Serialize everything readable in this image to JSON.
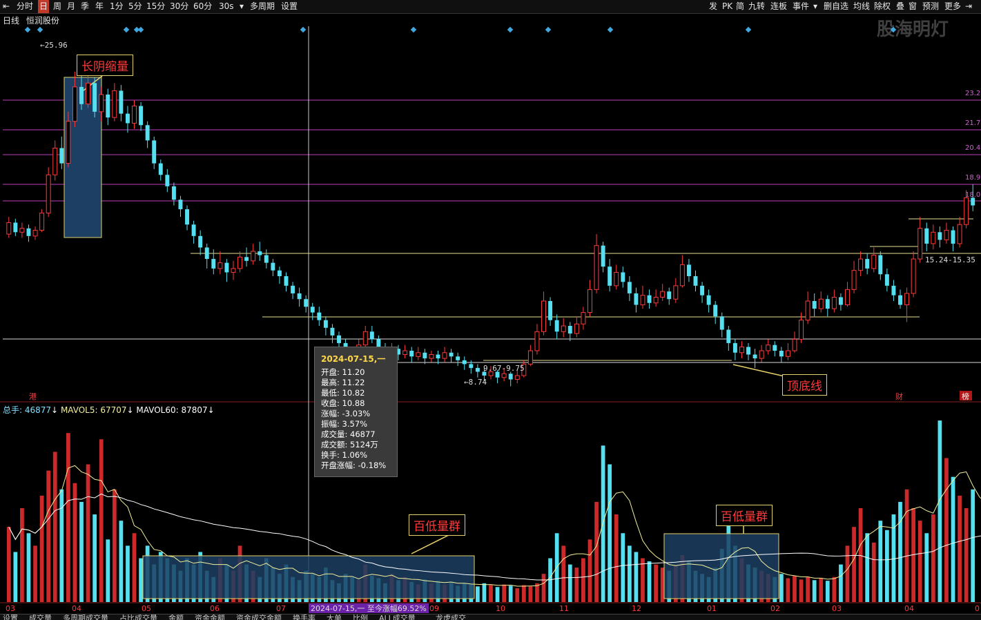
{
  "toolbar": {
    "left": [
      "分时",
      "日",
      "周",
      "月",
      "季",
      "年",
      "1分",
      "5分",
      "15分",
      "30分",
      "60分",
      "30s",
      "多周期",
      "设置"
    ],
    "active": "日",
    "right": [
      "发",
      "PK",
      "简",
      "九转",
      "连板",
      "事件",
      "删自选",
      "均线",
      "除权",
      "叠",
      "窗",
      "预测",
      "更多"
    ]
  },
  "info": {
    "period": "日线",
    "stock": "恒润股份"
  },
  "watermark": "股海明灯",
  "price_labels": {
    "high": "25.96",
    "low": "8.74",
    "range_low": "9.67-9.75",
    "range_high": "15.24-15.35"
  },
  "right_axis": [
    "23.2",
    "21.7",
    "20.4",
    "18.9",
    "18.0"
  ],
  "markers": {
    "hk": "港",
    "cai": "财",
    "bang": "榜"
  },
  "annotations": {
    "long_bear": "长阴缩量",
    "top_bottom": "顶底线",
    "low_vol_1": "百低量群",
    "low_vol_2": "百低量群"
  },
  "tooltip": {
    "date": "2024-07-15,一",
    "rows": [
      {
        "label": "开盘",
        "value": "11.20"
      },
      {
        "label": "最高",
        "value": "11.22"
      },
      {
        "label": "最低",
        "value": "10.82"
      },
      {
        "label": "收盘",
        "value": "10.88"
      },
      {
        "label": "涨幅",
        "value": "-3.03%"
      },
      {
        "label": "振幅",
        "value": "3.57%"
      },
      {
        "label": "成交量",
        "value": "46877"
      },
      {
        "label": "成交额",
        "value": "5124万"
      },
      {
        "label": "换手",
        "value": "1.06%"
      },
      {
        "label": "开盘涨幅",
        "value": "-0.18%"
      }
    ]
  },
  "volume_legend": {
    "total": "总手: 46877",
    "ma5": "MAVOL5: 67707",
    "ma60": "MAVOL60: 87807"
  },
  "cursor_label": "2024-07-15,一 至今涨幅69.52%",
  "bottom_tabs": [
    "设置",
    "成交量",
    "多周期成交量",
    "占比成交量",
    "金额",
    "资金金额",
    "资金成交金额",
    "换手率",
    "大单",
    "比例",
    "ALL成交量",
    "龙虎成交"
  ],
  "chart_data": {
    "type": "candlestick",
    "title": "恒润股份 日线",
    "x_months": [
      "03",
      "04",
      "05",
      "06",
      "07",
      "08",
      "09",
      "10",
      "11",
      "12",
      "01",
      "02",
      "03",
      "04",
      "0"
    ],
    "price": {
      "ylim": [
        8.0,
        27.5
      ],
      "candles": [
        {
          "o": 16.7,
          "c": 17.3,
          "h": 17.6,
          "l": 16.5
        },
        {
          "o": 17.3,
          "c": 16.8,
          "h": 17.5,
          "l": 16.6
        },
        {
          "o": 16.8,
          "c": 17.0,
          "h": 17.3,
          "l": 16.5
        },
        {
          "o": 17.0,
          "c": 16.6,
          "h": 17.2,
          "l": 16.3
        },
        {
          "o": 16.6,
          "c": 16.9,
          "h": 17.1,
          "l": 16.4
        },
        {
          "o": 16.9,
          "c": 17.8,
          "h": 18.0,
          "l": 16.8
        },
        {
          "o": 17.8,
          "c": 19.8,
          "h": 20.2,
          "l": 17.6
        },
        {
          "o": 19.8,
          "c": 21.2,
          "h": 21.6,
          "l": 19.5
        },
        {
          "o": 21.2,
          "c": 20.4,
          "h": 21.8,
          "l": 20.1
        },
        {
          "o": 20.4,
          "c": 22.6,
          "h": 23.1,
          "l": 20.2
        },
        {
          "o": 22.6,
          "c": 24.4,
          "h": 25.2,
          "l": 22.3
        },
        {
          "o": 24.4,
          "c": 23.5,
          "h": 25.4,
          "l": 23.2
        },
        {
          "o": 23.5,
          "c": 24.6,
          "h": 25.96,
          "l": 23.3
        },
        {
          "o": 24.6,
          "c": 23.1,
          "h": 24.9,
          "l": 22.8
        },
        {
          "o": 23.1,
          "c": 24.0,
          "h": 24.4,
          "l": 22.6
        },
        {
          "o": 24.0,
          "c": 22.8,
          "h": 24.3,
          "l": 22.4
        },
        {
          "o": 22.8,
          "c": 24.2,
          "h": 24.6,
          "l": 22.6
        },
        {
          "o": 24.2,
          "c": 23.0,
          "h": 24.5,
          "l": 22.6
        },
        {
          "o": 23.0,
          "c": 22.5,
          "h": 23.4,
          "l": 22.0
        },
        {
          "o": 22.5,
          "c": 23.4,
          "h": 23.7,
          "l": 22.2
        },
        {
          "o": 23.4,
          "c": 22.4,
          "h": 23.6,
          "l": 22.1
        },
        {
          "o": 22.4,
          "c": 21.6,
          "h": 22.6,
          "l": 21.2
        },
        {
          "o": 21.6,
          "c": 20.4,
          "h": 21.8,
          "l": 20.1
        },
        {
          "o": 20.4,
          "c": 19.8,
          "h": 20.6,
          "l": 19.5
        },
        {
          "o": 19.8,
          "c": 19.2,
          "h": 20.1,
          "l": 18.9
        },
        {
          "o": 19.2,
          "c": 18.5,
          "h": 19.4,
          "l": 18.2
        },
        {
          "o": 18.5,
          "c": 18.0,
          "h": 18.7,
          "l": 17.6
        },
        {
          "o": 18.0,
          "c": 17.2,
          "h": 18.2,
          "l": 16.9
        },
        {
          "o": 17.2,
          "c": 16.6,
          "h": 17.4,
          "l": 16.2
        },
        {
          "o": 16.6,
          "c": 16.0,
          "h": 16.9,
          "l": 15.6
        },
        {
          "o": 16.0,
          "c": 15.4,
          "h": 16.2,
          "l": 14.9
        },
        {
          "o": 15.4,
          "c": 14.9,
          "h": 15.9,
          "l": 14.6
        },
        {
          "o": 14.9,
          "c": 15.2,
          "h": 15.8,
          "l": 14.6
        },
        {
          "o": 15.2,
          "c": 14.7,
          "h": 15.4,
          "l": 14.2
        },
        {
          "o": 14.7,
          "c": 14.9,
          "h": 15.3,
          "l": 14.3
        },
        {
          "o": 14.9,
          "c": 15.5,
          "h": 15.8,
          "l": 14.7
        },
        {
          "o": 15.5,
          "c": 15.3,
          "h": 16.0,
          "l": 15.0
        },
        {
          "o": 15.3,
          "c": 15.8,
          "h": 16.2,
          "l": 15.1
        },
        {
          "o": 15.8,
          "c": 15.6,
          "h": 16.3,
          "l": 15.3
        },
        {
          "o": 15.6,
          "c": 15.2,
          "h": 15.9,
          "l": 14.9
        },
        {
          "o": 15.2,
          "c": 14.8,
          "h": 15.4,
          "l": 14.5
        },
        {
          "o": 14.8,
          "c": 14.5,
          "h": 15.0,
          "l": 14.1
        },
        {
          "o": 14.5,
          "c": 14.0,
          "h": 14.7,
          "l": 13.7
        },
        {
          "o": 14.0,
          "c": 13.6,
          "h": 14.2,
          "l": 13.3
        },
        {
          "o": 13.6,
          "c": 13.3,
          "h": 13.9,
          "l": 12.9
        },
        {
          "o": 13.3,
          "c": 12.9,
          "h": 13.5,
          "l": 12.6
        },
        {
          "o": 12.9,
          "c": 12.6,
          "h": 13.1,
          "l": 12.2
        },
        {
          "o": 12.6,
          "c": 12.2,
          "h": 12.9,
          "l": 11.9
        },
        {
          "o": 12.2,
          "c": 11.8,
          "h": 12.4,
          "l": 11.4
        },
        {
          "o": 11.8,
          "c": 11.4,
          "h": 12.0,
          "l": 11.0
        },
        {
          "o": 11.4,
          "c": 11.0,
          "h": 11.6,
          "l": 10.7
        },
        {
          "o": 11.0,
          "c": 10.5,
          "h": 11.2,
          "l": 10.1
        },
        {
          "o": 10.5,
          "c": 10.2,
          "h": 10.8,
          "l": 9.9
        },
        {
          "o": 10.2,
          "c": 10.9,
          "h": 11.2,
          "l": 10.0
        },
        {
          "o": 10.9,
          "c": 11.6,
          "h": 11.9,
          "l": 10.6
        },
        {
          "o": 11.6,
          "c": 11.2,
          "h": 11.9,
          "l": 11.0
        },
        {
          "o": 11.2,
          "c": 10.8,
          "h": 11.4,
          "l": 10.5
        },
        {
          "o": 10.8,
          "c": 10.5,
          "h": 11.0,
          "l": 10.2
        },
        {
          "o": 10.5,
          "c": 10.7,
          "h": 11.0,
          "l": 10.3
        },
        {
          "o": 10.7,
          "c": 10.4,
          "h": 10.9,
          "l": 10.1
        },
        {
          "o": 10.4,
          "c": 10.6,
          "h": 10.9,
          "l": 10.2
        },
        {
          "o": 10.6,
          "c": 10.3,
          "h": 10.8,
          "l": 10.0
        },
        {
          "o": 10.3,
          "c": 10.5,
          "h": 10.8,
          "l": 10.1
        },
        {
          "o": 10.5,
          "c": 10.2,
          "h": 10.7,
          "l": 9.9
        },
        {
          "o": 10.2,
          "c": 10.4,
          "h": 10.6,
          "l": 10.0
        },
        {
          "o": 10.4,
          "c": 10.2,
          "h": 10.6,
          "l": 9.9
        },
        {
          "o": 10.2,
          "c": 10.5,
          "h": 10.8,
          "l": 10.0
        },
        {
          "o": 10.5,
          "c": 10.3,
          "h": 10.7,
          "l": 10.0
        },
        {
          "o": 10.3,
          "c": 10.1,
          "h": 10.5,
          "l": 9.8
        },
        {
          "o": 10.1,
          "c": 9.9,
          "h": 10.3,
          "l": 9.6
        },
        {
          "o": 9.9,
          "c": 9.7,
          "h": 10.1,
          "l": 9.4
        },
        {
          "o": 9.7,
          "c": 9.5,
          "h": 9.9,
          "l": 9.2
        },
        {
          "o": 9.5,
          "c": 9.3,
          "h": 9.7,
          "l": 9.0
        },
        {
          "o": 9.3,
          "c": 9.5,
          "h": 9.8,
          "l": 9.1
        },
        {
          "o": 9.5,
          "c": 9.2,
          "h": 9.6,
          "l": 8.9
        },
        {
          "o": 9.2,
          "c": 9.4,
          "h": 9.7,
          "l": 9.0
        },
        {
          "o": 9.4,
          "c": 9.1,
          "h": 9.5,
          "l": 8.74
        },
        {
          "o": 9.1,
          "c": 9.3,
          "h": 9.6,
          "l": 8.9
        },
        {
          "o": 9.3,
          "c": 9.9,
          "h": 10.1,
          "l": 9.2
        },
        {
          "o": 9.9,
          "c": 10.6,
          "h": 10.9,
          "l": 9.8
        },
        {
          "o": 10.6,
          "c": 11.6,
          "h": 12.0,
          "l": 10.4
        },
        {
          "o": 11.6,
          "c": 13.2,
          "h": 13.7,
          "l": 11.4
        },
        {
          "o": 13.2,
          "c": 12.2,
          "h": 13.4,
          "l": 11.9
        },
        {
          "o": 12.2,
          "c": 11.6,
          "h": 12.5,
          "l": 11.2
        },
        {
          "o": 11.6,
          "c": 11.9,
          "h": 12.3,
          "l": 11.3
        },
        {
          "o": 11.9,
          "c": 11.5,
          "h": 12.1,
          "l": 11.1
        },
        {
          "o": 11.5,
          "c": 12.0,
          "h": 12.4,
          "l": 11.3
        },
        {
          "o": 12.0,
          "c": 12.6,
          "h": 12.9,
          "l": 11.7
        },
        {
          "o": 12.6,
          "c": 13.8,
          "h": 14.3,
          "l": 12.4
        },
        {
          "o": 13.8,
          "c": 16.1,
          "h": 16.7,
          "l": 13.6
        },
        {
          "o": 16.1,
          "c": 15.0,
          "h": 16.3,
          "l": 14.7
        },
        {
          "o": 15.0,
          "c": 14.0,
          "h": 15.4,
          "l": 13.7
        },
        {
          "o": 14.0,
          "c": 14.7,
          "h": 15.1,
          "l": 13.8
        },
        {
          "o": 14.7,
          "c": 14.2,
          "h": 15.0,
          "l": 13.9
        },
        {
          "o": 14.2,
          "c": 13.6,
          "h": 14.5,
          "l": 13.2
        },
        {
          "o": 13.6,
          "c": 13.0,
          "h": 13.9,
          "l": 12.6
        },
        {
          "o": 13.0,
          "c": 13.5,
          "h": 14.0,
          "l": 12.8
        },
        {
          "o": 13.5,
          "c": 13.1,
          "h": 13.8,
          "l": 12.8
        },
        {
          "o": 13.1,
          "c": 13.4,
          "h": 13.8,
          "l": 12.9
        },
        {
          "o": 13.4,
          "c": 13.7,
          "h": 14.1,
          "l": 13.2
        },
        {
          "o": 13.7,
          "c": 13.3,
          "h": 13.9,
          "l": 13.0
        },
        {
          "o": 13.3,
          "c": 14.0,
          "h": 14.4,
          "l": 13.1
        },
        {
          "o": 14.0,
          "c": 15.1,
          "h": 15.6,
          "l": 13.9
        },
        {
          "o": 15.1,
          "c": 14.5,
          "h": 15.4,
          "l": 14.2
        },
        {
          "o": 14.5,
          "c": 14.0,
          "h": 14.8,
          "l": 13.7
        },
        {
          "o": 14.0,
          "c": 13.5,
          "h": 14.2,
          "l": 13.1
        },
        {
          "o": 13.5,
          "c": 13.0,
          "h": 13.8,
          "l": 12.6
        },
        {
          "o": 13.0,
          "c": 12.4,
          "h": 13.2,
          "l": 12.0
        },
        {
          "o": 12.4,
          "c": 11.7,
          "h": 12.6,
          "l": 11.3
        },
        {
          "o": 11.7,
          "c": 11.0,
          "h": 11.9,
          "l": 10.6
        },
        {
          "o": 11.0,
          "c": 10.5,
          "h": 11.2,
          "l": 10.1
        },
        {
          "o": 10.5,
          "c": 10.8,
          "h": 11.1,
          "l": 10.2
        },
        {
          "o": 10.8,
          "c": 10.4,
          "h": 11.0,
          "l": 10.1
        },
        {
          "o": 10.4,
          "c": 10.2,
          "h": 10.7,
          "l": 9.7
        },
        {
          "o": 10.2,
          "c": 10.6,
          "h": 10.9,
          "l": 10.0
        },
        {
          "o": 10.6,
          "c": 10.9,
          "h": 11.2,
          "l": 10.4
        },
        {
          "o": 10.9,
          "c": 10.6,
          "h": 11.1,
          "l": 10.3
        },
        {
          "o": 10.6,
          "c": 10.3,
          "h": 10.8,
          "l": 10.0
        },
        {
          "o": 10.3,
          "c": 10.6,
          "h": 11.0,
          "l": 10.1
        },
        {
          "o": 10.6,
          "c": 11.2,
          "h": 11.6,
          "l": 10.5
        },
        {
          "o": 11.2,
          "c": 12.2,
          "h": 12.6,
          "l": 11.0
        },
        {
          "o": 12.2,
          "c": 13.2,
          "h": 13.7,
          "l": 12.0
        },
        {
          "o": 13.2,
          "c": 12.8,
          "h": 13.6,
          "l": 12.4
        },
        {
          "o": 12.8,
          "c": 13.3,
          "h": 13.7,
          "l": 12.6
        },
        {
          "o": 13.3,
          "c": 12.8,
          "h": 13.5,
          "l": 12.4
        },
        {
          "o": 12.8,
          "c": 13.4,
          "h": 13.8,
          "l": 12.6
        },
        {
          "o": 13.4,
          "c": 13.0,
          "h": 13.6,
          "l": 12.7
        },
        {
          "o": 13.0,
          "c": 13.8,
          "h": 14.2,
          "l": 12.9
        },
        {
          "o": 13.8,
          "c": 14.8,
          "h": 15.3,
          "l": 13.6
        },
        {
          "o": 14.8,
          "c": 15.4,
          "h": 15.8,
          "l": 14.5
        },
        {
          "o": 15.4,
          "c": 14.9,
          "h": 15.7,
          "l": 14.6
        },
        {
          "o": 14.9,
          "c": 15.6,
          "h": 16.0,
          "l": 14.7
        },
        {
          "o": 15.6,
          "c": 14.6,
          "h": 15.8,
          "l": 14.3
        },
        {
          "o": 14.6,
          "c": 14.0,
          "h": 14.9,
          "l": 13.7
        },
        {
          "o": 14.0,
          "c": 13.5,
          "h": 14.3,
          "l": 13.2
        },
        {
          "o": 13.5,
          "c": 13.0,
          "h": 13.8,
          "l": 12.8
        },
        {
          "o": 13.0,
          "c": 13.6,
          "h": 13.9,
          "l": 12.1
        },
        {
          "o": 13.6,
          "c": 15.4,
          "h": 15.8,
          "l": 13.4
        },
        {
          "o": 15.4,
          "c": 17.0,
          "h": 17.6,
          "l": 15.2
        },
        {
          "o": 17.0,
          "c": 16.2,
          "h": 17.3,
          "l": 15.8
        },
        {
          "o": 16.2,
          "c": 16.8,
          "h": 17.2,
          "l": 15.9
        },
        {
          "o": 16.8,
          "c": 16.4,
          "h": 17.1,
          "l": 16.0
        },
        {
          "o": 16.4,
          "c": 16.9,
          "h": 17.3,
          "l": 16.2
        },
        {
          "o": 16.9,
          "c": 16.2,
          "h": 17.1,
          "l": 15.8
        },
        {
          "o": 16.2,
          "c": 17.2,
          "h": 17.6,
          "l": 16.0
        },
        {
          "o": 17.2,
          "c": 18.6,
          "h": 19.0,
          "l": 17.0
        },
        {
          "o": 18.6,
          "c": 18.2,
          "h": 19.3,
          "l": 17.9
        }
      ]
    },
    "volume": {
      "ylim": [
        0,
        300000
      ],
      "bars": [
        120,
        80,
        150,
        110,
        90,
        170,
        210,
        240,
        180,
        270,
        190,
        160,
        220,
        140,
        260,
        100,
        180,
        130,
        90,
        110,
        70,
        90,
        60,
        80,
        70,
        60,
        50,
        70,
        60,
        80,
        50,
        40,
        70,
        60,
        50,
        90,
        60,
        50,
        40,
        70,
        55,
        45,
        60,
        40,
        35,
        50,
        45,
        40,
        55,
        35,
        30,
        45,
        40,
        35,
        60,
        42,
        38,
        30,
        45,
        35,
        40,
        32,
        28,
        36,
        30,
        34,
        28,
        32,
        26,
        30,
        28,
        25,
        30,
        27,
        24,
        28,
        26,
        22,
        27,
        25,
        30,
        45,
        70,
        110,
        90,
        60,
        55,
        70,
        100,
        160,
        250,
        220,
        140,
        110,
        90,
        80,
        70,
        65,
        60,
        55,
        50,
        60,
        75,
        65,
        50,
        45,
        40,
        55,
        85,
        130,
        90,
        70,
        60,
        55,
        50,
        45,
        40,
        45,
        38,
        42,
        36,
        40,
        35,
        38,
        34,
        40,
        60,
        90,
        120,
        150,
        110,
        95,
        130,
        115,
        140,
        160,
        180,
        150,
        130,
        110,
        140,
        290,
        230,
        200,
        170,
        150,
        180,
        140,
        150,
        260,
        300
      ],
      "ma5_max": 230,
      "ma60_max": 160
    }
  }
}
